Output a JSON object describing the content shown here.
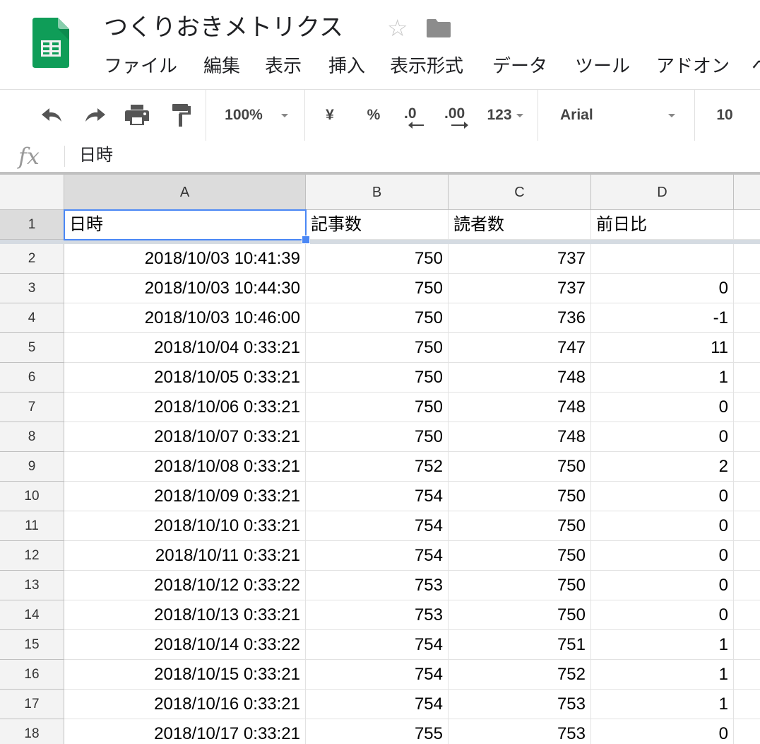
{
  "header": {
    "title": "つくりおきメトリクス",
    "star_icon": "star-outline-icon",
    "folder_icon": "folder-icon",
    "logo_icon": "google-sheets-logo-icon",
    "logo_color": "#0f9d58"
  },
  "menu": {
    "items": [
      "ファイル",
      "編集",
      "表示",
      "挿入",
      "表示形式",
      "データ",
      "ツール",
      "アドオン",
      "ヘ"
    ]
  },
  "toolbar": {
    "zoom": "100%",
    "currency": "¥",
    "percent": "%",
    "decrease_decimal": ".0",
    "increase_decimal": ".00",
    "more_formats": "123",
    "font": "Arial",
    "font_size": "10",
    "icons": [
      "undo-icon",
      "redo-icon",
      "print-icon",
      "paint-format-icon"
    ]
  },
  "formula_bar": {
    "fx": "fx",
    "value": "日時"
  },
  "grid": {
    "selection_color": "#4a87f5",
    "columns": [
      "A",
      "B",
      "C",
      "D"
    ],
    "header_row": {
      "row": "1",
      "cells": [
        "日時",
        "記事数",
        "読者数",
        "前日比"
      ]
    },
    "rows": [
      {
        "row": "2",
        "cells": [
          "2018/10/03 10:41:39",
          "750",
          "737",
          ""
        ]
      },
      {
        "row": "3",
        "cells": [
          "2018/10/03 10:44:30",
          "750",
          "737",
          "0"
        ]
      },
      {
        "row": "4",
        "cells": [
          "2018/10/03 10:46:00",
          "750",
          "736",
          "-1"
        ]
      },
      {
        "row": "5",
        "cells": [
          "2018/10/04 0:33:21",
          "750",
          "747",
          "11"
        ]
      },
      {
        "row": "6",
        "cells": [
          "2018/10/05 0:33:21",
          "750",
          "748",
          "1"
        ]
      },
      {
        "row": "7",
        "cells": [
          "2018/10/06 0:33:21",
          "750",
          "748",
          "0"
        ]
      },
      {
        "row": "8",
        "cells": [
          "2018/10/07 0:33:21",
          "750",
          "748",
          "0"
        ]
      },
      {
        "row": "9",
        "cells": [
          "2018/10/08 0:33:21",
          "752",
          "750",
          "2"
        ]
      },
      {
        "row": "10",
        "cells": [
          "2018/10/09 0:33:21",
          "754",
          "750",
          "0"
        ]
      },
      {
        "row": "11",
        "cells": [
          "2018/10/10 0:33:21",
          "754",
          "750",
          "0"
        ]
      },
      {
        "row": "12",
        "cells": [
          "2018/10/11 0:33:21",
          "754",
          "750",
          "0"
        ]
      },
      {
        "row": "13",
        "cells": [
          "2018/10/12 0:33:22",
          "753",
          "750",
          "0"
        ]
      },
      {
        "row": "14",
        "cells": [
          "2018/10/13 0:33:21",
          "753",
          "750",
          "0"
        ]
      },
      {
        "row": "15",
        "cells": [
          "2018/10/14 0:33:22",
          "754",
          "751",
          "1"
        ]
      },
      {
        "row": "16",
        "cells": [
          "2018/10/15 0:33:21",
          "754",
          "752",
          "1"
        ]
      },
      {
        "row": "17",
        "cells": [
          "2018/10/16 0:33:21",
          "754",
          "753",
          "1"
        ]
      },
      {
        "row": "18",
        "cells": [
          "2018/10/17 0:33:21",
          "755",
          "753",
          "0"
        ]
      }
    ]
  }
}
